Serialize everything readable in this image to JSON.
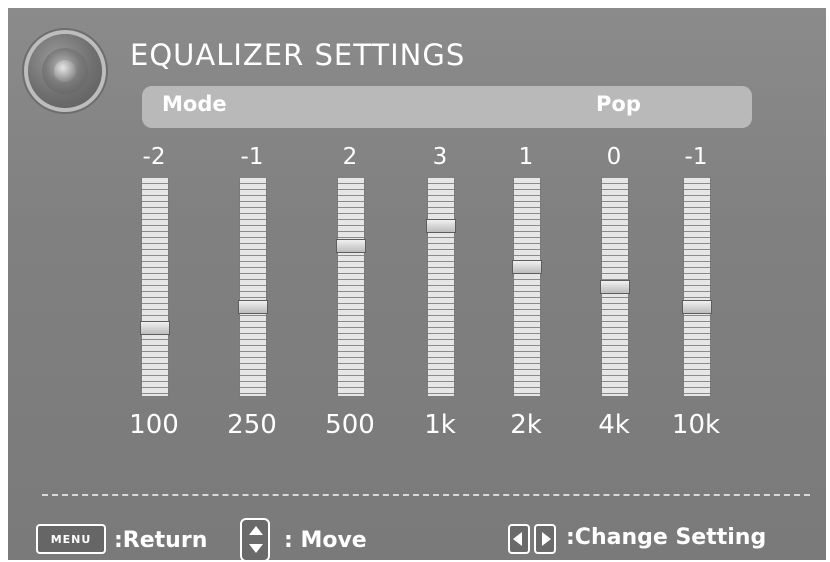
{
  "header": {
    "title": "EQUALIZER SETTINGS"
  },
  "mode": {
    "label": "Mode",
    "value": "Pop"
  },
  "eq": {
    "range": [
      -5,
      5
    ],
    "bands": [
      {
        "value": "-2",
        "level": -2,
        "freq": "100"
      },
      {
        "value": "-1",
        "level": -1,
        "freq": "250"
      },
      {
        "value": "2",
        "level": 2,
        "freq": "500"
      },
      {
        "value": "3",
        "level": 3,
        "freq": "1k"
      },
      {
        "value": "1",
        "level": 1,
        "freq": "2k"
      },
      {
        "value": "0",
        "level": 0,
        "freq": "4k"
      },
      {
        "value": "-1",
        "level": -1,
        "freq": "10k"
      }
    ]
  },
  "footer": {
    "menu_key": "MENU",
    "return_label": ":Return",
    "move_label": ": Move",
    "change_label": ":Change Setting"
  },
  "icons": {
    "speaker": "speaker-icon",
    "menu": "menu-key-icon",
    "updown": "up-down-arrows-icon",
    "leftright": "left-right-arrows-icon"
  }
}
